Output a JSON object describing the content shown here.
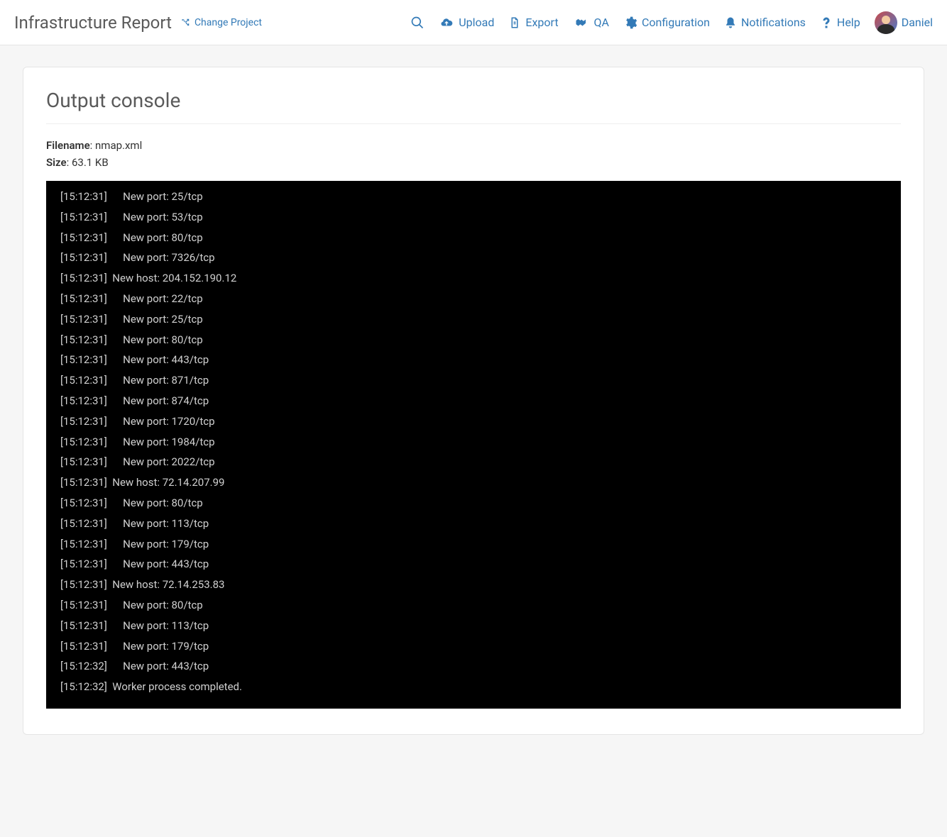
{
  "header": {
    "app_title": "Infrastructure Report",
    "change_project": "Change Project",
    "nav": {
      "upload": "Upload",
      "export": "Export",
      "qa": "QA",
      "configuration": "Configuration",
      "notifications": "Notifications",
      "help": "Help"
    },
    "user": "Daniel"
  },
  "page": {
    "title": "Output console",
    "filename_label": "Filename",
    "filename": "nmap.xml",
    "size_label": "Size",
    "size": "63.1 KB"
  },
  "console": {
    "lines": [
      {
        "ts": "[15:12:31]",
        "msg": "    New port: 25/tcp"
      },
      {
        "ts": "[15:12:31]",
        "msg": "    New port: 53/tcp"
      },
      {
        "ts": "[15:12:31]",
        "msg": "    New port: 80/tcp"
      },
      {
        "ts": "[15:12:31]",
        "msg": "    New port: 7326/tcp"
      },
      {
        "ts": "[15:12:31]",
        "msg": "New host: 204.152.190.12"
      },
      {
        "ts": "[15:12:31]",
        "msg": "    New port: 22/tcp"
      },
      {
        "ts": "[15:12:31]",
        "msg": "    New port: 25/tcp"
      },
      {
        "ts": "[15:12:31]",
        "msg": "    New port: 80/tcp"
      },
      {
        "ts": "[15:12:31]",
        "msg": "    New port: 443/tcp"
      },
      {
        "ts": "[15:12:31]",
        "msg": "    New port: 871/tcp"
      },
      {
        "ts": "[15:12:31]",
        "msg": "    New port: 874/tcp"
      },
      {
        "ts": "[15:12:31]",
        "msg": "    New port: 1720/tcp"
      },
      {
        "ts": "[15:12:31]",
        "msg": "    New port: 1984/tcp"
      },
      {
        "ts": "[15:12:31]",
        "msg": "    New port: 2022/tcp"
      },
      {
        "ts": "[15:12:31]",
        "msg": "New host: 72.14.207.99"
      },
      {
        "ts": "[15:12:31]",
        "msg": "    New port: 80/tcp"
      },
      {
        "ts": "[15:12:31]",
        "msg": "    New port: 113/tcp"
      },
      {
        "ts": "[15:12:31]",
        "msg": "    New port: 179/tcp"
      },
      {
        "ts": "[15:12:31]",
        "msg": "    New port: 443/tcp"
      },
      {
        "ts": "[15:12:31]",
        "msg": "New host: 72.14.253.83"
      },
      {
        "ts": "[15:12:31]",
        "msg": "    New port: 80/tcp"
      },
      {
        "ts": "[15:12:31]",
        "msg": "    New port: 113/tcp"
      },
      {
        "ts": "[15:12:31]",
        "msg": "    New port: 179/tcp"
      },
      {
        "ts": "[15:12:32]",
        "msg": "    New port: 443/tcp"
      },
      {
        "ts": "[15:12:32]",
        "msg": "Worker process completed."
      }
    ]
  }
}
